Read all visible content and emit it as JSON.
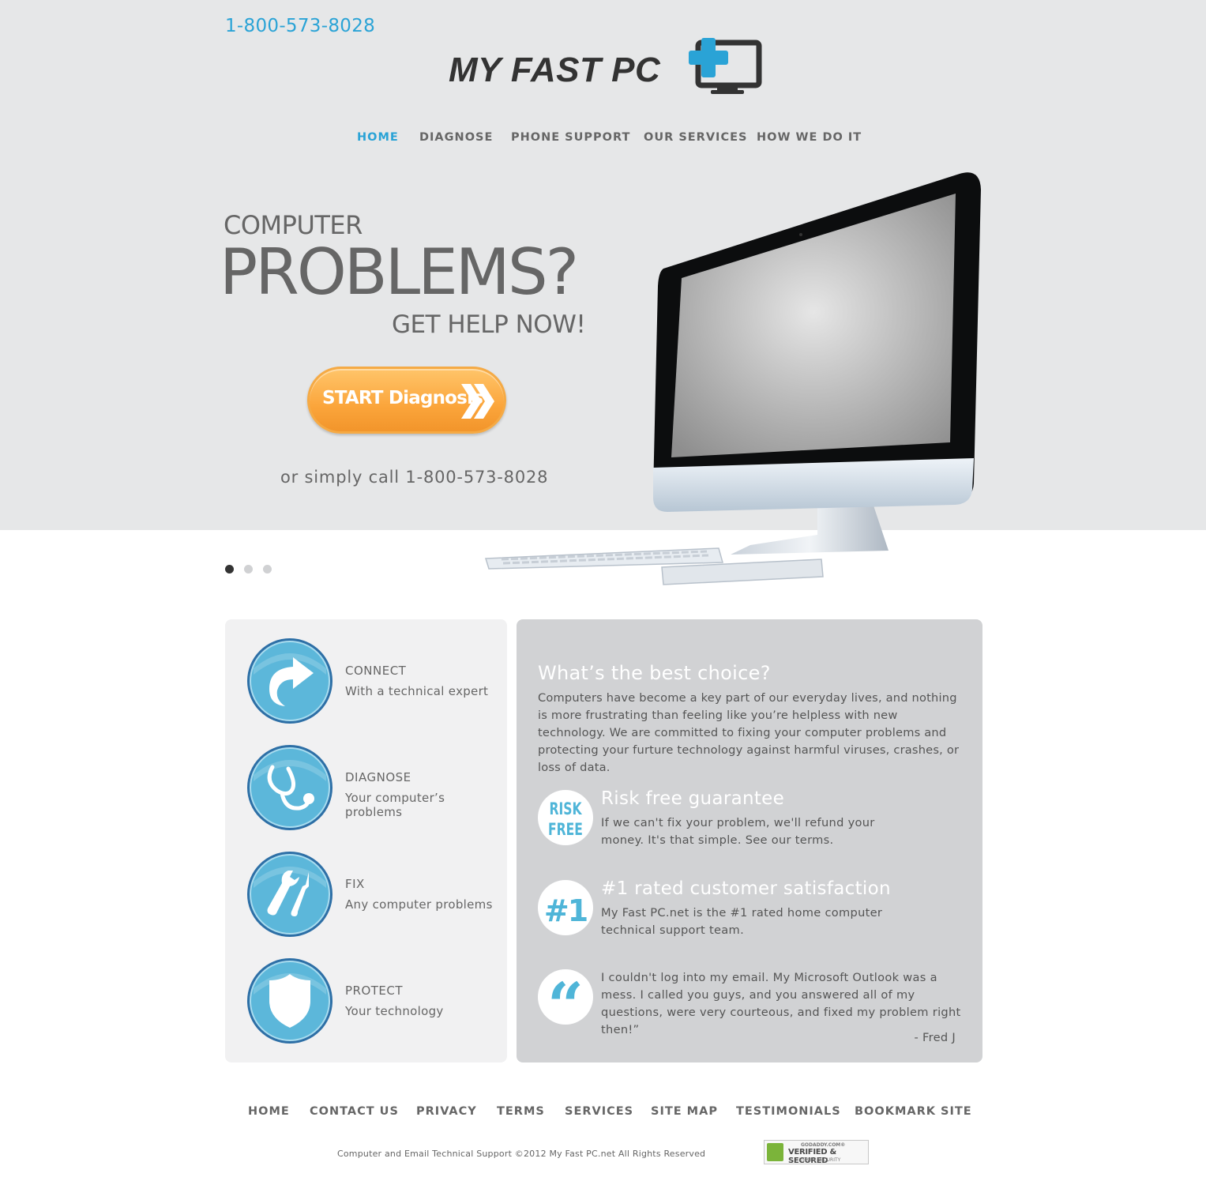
{
  "header": {
    "phone": "1-800-573-8028",
    "logo_text": "MY FAST PC"
  },
  "nav": {
    "items": [
      {
        "label": "HOME",
        "active": true
      },
      {
        "label": "DIAGNOSE",
        "active": false
      },
      {
        "label": "PHONE SUPPORT",
        "active": false
      },
      {
        "label": "OUR SERVICES",
        "active": false
      },
      {
        "label": "HOW WE DO IT",
        "active": false
      }
    ]
  },
  "hero": {
    "line1": "COMPUTER",
    "line2": "PROBLEMS?",
    "line3": "GET HELP NOW!",
    "cta_label": "START Diagnosis",
    "call_text": "or simply call 1-800-573-8028",
    "slides_total": 3,
    "slide_active": 1
  },
  "features": [
    {
      "icon": "share-arrow-icon",
      "title": "CONNECT",
      "subtitle": "With a technical expert"
    },
    {
      "icon": "stethoscope-icon",
      "title": "DIAGNOSE",
      "subtitle": "Your computer’s problems"
    },
    {
      "icon": "tools-icon",
      "title": "FIX",
      "subtitle": "Any computer problems"
    },
    {
      "icon": "shield-icon",
      "title": "PROTECT",
      "subtitle": "Your technology"
    }
  ],
  "choice": {
    "title": "What’s the best choice?",
    "body": "Computers have become a key part of our everyday lives, and nothing is more frustrating than feeling like you’re helpless with new technology. We are committed to fixing your computer problems and protecting your furture technology against harmful viruses, crashes, or loss of data.",
    "risk_badge_line1": "RISK",
    "risk_badge_line2": "FREE",
    "risk_title": "Risk free guarantee",
    "risk_text": "If we can't fix your problem, we'll refund your money. It's that simple. See our terms.",
    "rated_badge": "#1",
    "rated_title": "#1 rated customer satisfaction",
    "rated_text": "My Fast PC.net is the #1 rated home computer technical support team.",
    "quote_badge": "“",
    "quote_text": "I couldn't log into my email. My Microsoft Outlook was a mess. I called you guys, and you answered all of my questions, were very courteous, and fixed my problem right then!”",
    "quote_author": "- Fred J"
  },
  "footer": {
    "links": [
      "HOME",
      "CONTACT US",
      "PRIVACY",
      "TERMS",
      "SERVICES",
      "SITE MAP",
      "TESTIMONIALS",
      "BOOKMARK SITE"
    ],
    "copyright": "Computer and Email Technical Support ©2012 My Fast PC.net All Rights Reserved",
    "seal_line1": "GODADDY.COM®",
    "seal_line2": "VERIFIED & SECURED",
    "seal_line3": "VERIFY SECURITY"
  },
  "colors": {
    "accent": "#2aa3d6",
    "hero_bg": "#e6e7e8",
    "cta": "#fba53b",
    "icon_blue": "#5cb7da"
  }
}
